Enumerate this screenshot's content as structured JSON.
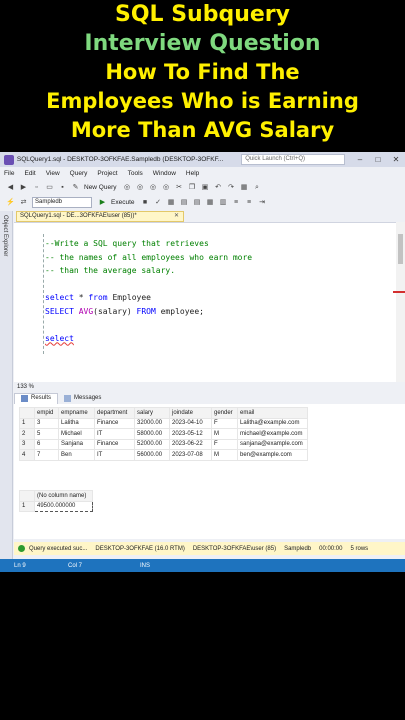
{
  "banner": {
    "line1": "SQL Subquery",
    "line2": "Interview Question",
    "line3": "How To Find The",
    "line4": "Employees Who is Earning",
    "line5": "More Than AVG Salary"
  },
  "window": {
    "title": "SQLQuery1.sql - DESKTOP-3OFKFAE.Sampledb (DESKTOP-3OFKF...",
    "quick_launch": "Quick Launch (Ctrl+Q)"
  },
  "menu": [
    "File",
    "Edit",
    "View",
    "Query",
    "Project",
    "Tools",
    "Window",
    "Help"
  ],
  "toolbar": {
    "new_query": "New Query",
    "database": "Sampledb",
    "execute": "Execute"
  },
  "side_panel": "Object Explorer",
  "doc_tab": "SQLQuery1.sql - DE...3OFKFAE\\user (85))*",
  "editor": {
    "line1": "--Write a SQL query that retrieves",
    "line2": "-- the names of all employees who earn more",
    "line3": "-- than the average salary.",
    "line4_kw1": "select",
    "line4_rest": " * ",
    "line4_kw2": "from",
    "line4_tbl": " Employee",
    "line5_kw1": "SELECT",
    "line5_fn": " AVG",
    "line5_arg": "(salary) ",
    "line5_kw2": "FROM",
    "line5_tbl": " employee;",
    "line6": "select"
  },
  "zoom": "133 %",
  "result_tabs": {
    "results": "Results",
    "messages": "Messages"
  },
  "table1": {
    "columns": [
      "empid",
      "empname",
      "department",
      "salary",
      "joindate",
      "gender",
      "email"
    ],
    "rows": [
      [
        "1",
        "3",
        "Lalitha",
        "Finance",
        "32000.00",
        "2023-04-10",
        "F",
        "Lalitha@example.com"
      ],
      [
        "2",
        "5",
        "Michael",
        "IT",
        "58000.00",
        "2023-05-12",
        "M",
        "michael@example.com"
      ],
      [
        "3",
        "6",
        "Sanjana",
        "Finance",
        "52000.00",
        "2023-06-22",
        "F",
        "sanjana@example.com"
      ],
      [
        "4",
        "7",
        "Ben",
        "IT",
        "56000.00",
        "2023-07-08",
        "M",
        "ben@example.com"
      ]
    ]
  },
  "table2": {
    "column": "(No column name)",
    "row_num": "1",
    "value": "49500.000000"
  },
  "query_status": {
    "message": "Query executed suc...",
    "server": "DESKTOP-3OFKFAE (16.0 RTM)",
    "user": "DESKTOP-3OFKFAE\\user (85)",
    "db": "Sampledb",
    "time": "00:00:00",
    "rows": "5 rows"
  },
  "statusbar": {
    "ln": "Ln 9",
    "col": "Col 7",
    "ins": "INS"
  },
  "colors": {
    "banner_yellow": "#fff000",
    "banner_green": "#7fd97f",
    "status_blue": "#1e73be"
  }
}
